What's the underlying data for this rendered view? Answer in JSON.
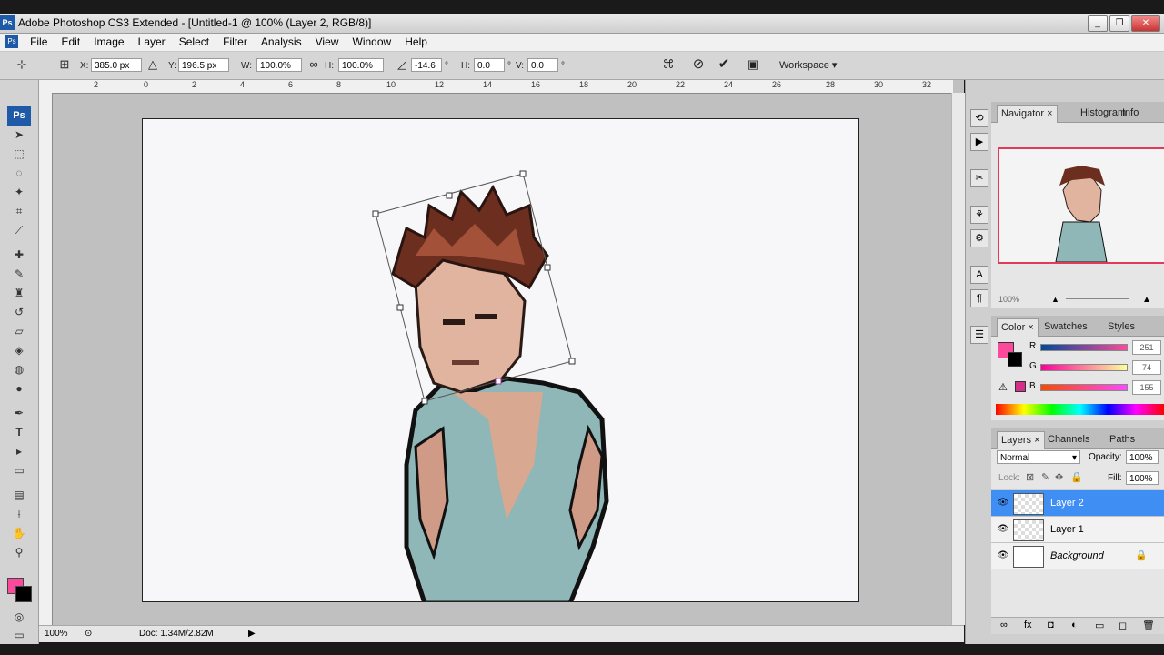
{
  "window": {
    "title": "Adobe Photoshop CS3 Extended - [Untitled-1 @ 100% (Layer 2, RGB/8)]",
    "app_icon": "Ps",
    "controls": [
      "minimize-icon",
      "restore-icon",
      "close-icon"
    ]
  },
  "menu": {
    "items": [
      "File",
      "Edit",
      "Image",
      "Layer",
      "Select",
      "Filter",
      "Analysis",
      "View",
      "Window",
      "Help"
    ]
  },
  "options": {
    "x_label": "X:",
    "x_value": "385.0 px",
    "y_label": "Y:",
    "y_value": "196.5 px",
    "w_label": "W:",
    "w_value": "100.0%",
    "h_label": "H:",
    "h_value": "100.0%",
    "angle_value": "-14.6",
    "deg_symbol": "°",
    "hskew_label": "H:",
    "hskew_value": "0.0",
    "vskew_label": "V:",
    "vskew_value": "0.0",
    "workspace_label": "Workspace ▾"
  },
  "ruler": {
    "ticks": [
      "2",
      "0",
      "2",
      "4",
      "6",
      "8",
      "10",
      "12",
      "14",
      "16",
      "18",
      "20",
      "22",
      "24",
      "26",
      "28",
      "30",
      "32"
    ]
  },
  "status": {
    "zoom": "100%",
    "doc": "Doc: 1.34M/2.82M"
  },
  "navigator": {
    "tabs": [
      "Navigator",
      "Histogram",
      "Info"
    ],
    "zoom": "100%"
  },
  "color": {
    "tabs": [
      "Color",
      "Swatches",
      "Styles"
    ],
    "r_label": "R",
    "r_value": "251",
    "g_label": "G",
    "g_value": "74",
    "b_label": "B",
    "b_value": "155",
    "foreground": "#fb4a9b",
    "background": "#000000"
  },
  "layers": {
    "tabs": [
      "Layers",
      "Channels",
      "Paths"
    ],
    "blend_mode": "Normal",
    "opacity_label": "Opacity:",
    "opacity_value": "100%",
    "lock_label": "Lock:",
    "fill_label": "Fill:",
    "fill_value": "100%",
    "items": [
      {
        "name": "Layer 2",
        "selected": true
      },
      {
        "name": "Layer 1",
        "selected": false
      },
      {
        "name": "Background",
        "selected": false,
        "locked": true
      }
    ]
  }
}
